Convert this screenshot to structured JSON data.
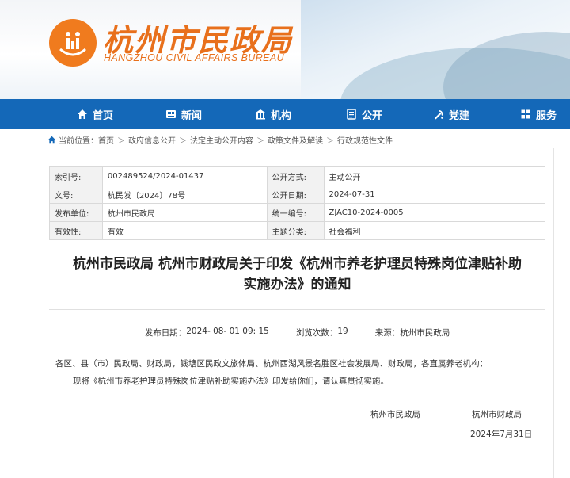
{
  "header": {
    "title": "杭州市民政局",
    "subtitle": "HANGZHOU CIVIL AFFAIRS BUREAU",
    "logo_icon": "civil-affairs-logo-icon",
    "brand_color": "#e8701c"
  },
  "nav": {
    "background": "#1468b8",
    "items": [
      {
        "label": "首页",
        "icon": "home-icon"
      },
      {
        "label": "新闻",
        "icon": "news-icon"
      },
      {
        "label": "机构",
        "icon": "institution-icon"
      },
      {
        "label": "公开",
        "icon": "disclosure-icon"
      },
      {
        "label": "党建",
        "icon": "party-icon"
      },
      {
        "label": "服务",
        "icon": "service-icon"
      }
    ]
  },
  "breadcrumb": {
    "prefix": "当前位置：",
    "items": [
      "首页",
      "政府信息公开",
      "法定主动公开内容",
      "政策文件及解读",
      "行政规范性文件"
    ],
    "separator": "＞"
  },
  "meta": {
    "rows": [
      {
        "l1": "索引号:",
        "v1": "002489524/2024-01437",
        "l2": "公开方式:",
        "v2": "主动公开"
      },
      {
        "l1": "文号:",
        "v1": "杭民发〔2024〕78号",
        "l2": "公开日期:",
        "v2": "2024-07-31"
      },
      {
        "l1": "发布单位:",
        "v1": "杭州市民政局",
        "l2": "统一编号:",
        "v2": "ZJAC10-2024-0005"
      },
      {
        "l1": "有效性:",
        "v1": "有效",
        "l2": "主题分类:",
        "v2": "社会福利"
      }
    ]
  },
  "doc": {
    "title_line1": "杭州市民政局 杭州市财政局关于印发《杭州市养老护理员特殊岗位津贴补助",
    "title_line2": "实施办法》的通知",
    "publish_label": "发布日期：",
    "publish_value": "2024- 08- 01 09: 15",
    "views_label": "浏览次数：",
    "views_value": "19",
    "source_label": "来源：",
    "source_value": "杭州市民政局",
    "para1": "各区、县（市）民政局、财政局，钱塘区民政文旅体局、杭州西湖风景名胜区社会发展局、财政局，各直属养老机构：",
    "para2": "现将《杭州市养老护理员特殊岗位津贴补助实施办法》印发给你们，请认真贯彻实施。",
    "signer1": "杭州市民政局",
    "signer2": "杭州市财政局",
    "date": "2024年7月31日"
  }
}
